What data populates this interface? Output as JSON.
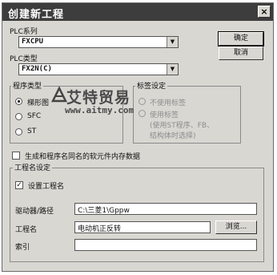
{
  "window": {
    "title": "创建新工程",
    "close_glyph": "×"
  },
  "plc_series": {
    "label": "PLC系列",
    "value": "FXCPU"
  },
  "plc_type": {
    "label": "PLC类型",
    "value": "FX2N(C)"
  },
  "buttons": {
    "ok": "确定",
    "cancel": "取消",
    "browse": "浏览..."
  },
  "program_type": {
    "title": "程序类型",
    "options": [
      {
        "label": "梯形图",
        "selected": true
      },
      {
        "label": "SFC",
        "selected": false
      },
      {
        "label": "ST",
        "selected": false
      }
    ]
  },
  "label_settings": {
    "title": "标签设定",
    "options": [
      "不使用标签",
      "使用标签",
      "(使用ST程序、FB、",
      "结构体时选择)"
    ]
  },
  "memory_checkbox": {
    "label": "生成和程序名同名的软元件内存数据",
    "checked": false
  },
  "project_name": {
    "title": "工程名设定",
    "set_name_label": "设置工程名",
    "set_name_checked": true,
    "drive_label": "驱动器/路径",
    "drive_value": "C:\\三菱1\\Gppw",
    "name_label": "工程名",
    "name_value": "电动机正反转",
    "index_label": "索引",
    "index_value": ""
  },
  "watermark": {
    "line1": "艾特贸易",
    "line2": "www.aitmy.com"
  }
}
